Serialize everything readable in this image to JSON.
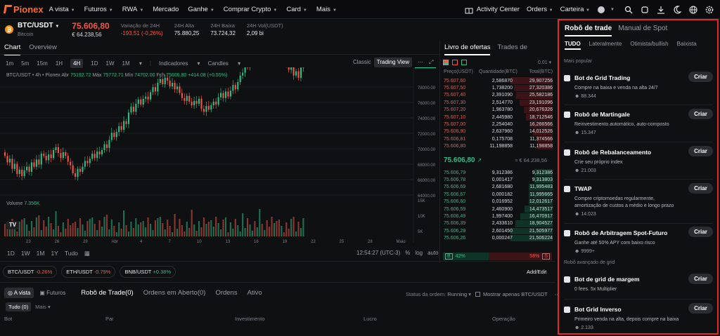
{
  "nav": {
    "logo": "Pionex",
    "items": [
      {
        "label": "A vista",
        "caret": true
      },
      {
        "label": "Futuros",
        "caret": true
      },
      {
        "label": "RWA",
        "caret": true
      },
      {
        "label": "Mercado",
        "caret": false
      },
      {
        "label": "Ganhe",
        "caret": true
      },
      {
        "label": "Comprar Crypto",
        "caret": true
      },
      {
        "label": "Card",
        "caret": true
      },
      {
        "label": "Mais",
        "caret": true
      }
    ],
    "activity": "Activity Center",
    "orders": "Orders",
    "wallet": "Carteira"
  },
  "ticker": {
    "pair": "BTC/USDT",
    "coin": "Bitcoin",
    "price": "75.606,80",
    "price_sub": "€ 64.238,56",
    "stats": [
      {
        "label": "Variação de 24H",
        "value": "-193,51 (-0,26%)",
        "color": "red"
      },
      {
        "label": "24H Alta",
        "value": "75.880,25"
      },
      {
        "label": "24H Baixa",
        "value": "73.724,32"
      },
      {
        "label": "24H Vol(USDT)",
        "value": "2,09 bi"
      }
    ]
  },
  "chart_tabs": [
    "Chart",
    "Overview"
  ],
  "toolbar": {
    "intervals": [
      "1m",
      "5m",
      "15m",
      "1H",
      "4H",
      "1D",
      "1W",
      "1M"
    ],
    "selected": "4H",
    "indicators": "Indicadores",
    "candles": "Candles",
    "views": [
      "Classic",
      "Trading View"
    ]
  },
  "ohlc": {
    "prefix": "BTC/USDT • 4h • Pionex",
    "abr_label": "Abr",
    "abr": "75192.72",
    "max_label": "Máx",
    "max": "75772.71",
    "min_label": "Mín",
    "min": "74702.00",
    "fch_label": "Fch",
    "fch": "75606.80",
    "chg": "+414.08 (+0.55%)"
  },
  "volume": {
    "label": "Volume",
    "value": "7.356K"
  },
  "chart_data": {
    "type": "candlestick",
    "y_ticks": [
      "78000.00",
      "76000.00",
      "74000.00",
      "72000.00",
      "70000.00",
      "68000.00",
      "66000.00",
      "64000.00"
    ],
    "x_ticks": [
      "23",
      "26",
      "29",
      "Abr",
      "4",
      "7",
      "10",
      "13",
      "16",
      "19",
      "22",
      "25",
      "28",
      "Maio"
    ],
    "last_price": "75606.80",
    "volume_ticks": [
      "15K",
      "10K",
      "5K"
    ],
    "ylim": [
      63000,
      79000
    ],
    "closes": [
      68700,
      67800,
      68300,
      66900,
      67600,
      66200,
      66800,
      65900,
      66700,
      67200,
      66500,
      67800,
      67200,
      68200,
      67500,
      69000,
      68700,
      68100,
      68900,
      68400,
      69500,
      69900,
      69100,
      68400,
      69200,
      68700,
      67900,
      67400,
      66300,
      65800,
      66900,
      66500,
      67200,
      68000,
      67700,
      68300,
      69000,
      68400,
      69300,
      68900,
      69500,
      70300,
      69800,
      70900,
      71900,
      71300,
      72000,
      72800,
      72300,
      73500,
      73100,
      74700,
      75500,
      74800,
      75900,
      76500,
      75800,
      76600,
      76900,
      76500,
      77500,
      78200,
      77600,
      78800,
      79300,
      78600,
      79500,
      79100,
      78300,
      78800,
      77900,
      78300,
      77400,
      76700,
      76300,
      77000,
      76200,
      75700,
      76300,
      75900,
      76600,
      75200,
      74800,
      75600,
      75100,
      75700,
      76200,
      75800,
      76800,
      77400,
      76700,
      77600,
      76900,
      77700,
      78500,
      77900,
      78900,
      79800,
      80200,
      81400,
      80900,
      81800,
      82500,
      82100,
      83200,
      84300,
      83700,
      84500,
      83600,
      83000,
      82300,
      83100,
      81900,
      81500,
      82600,
      81700,
      81200,
      80600,
      81400,
      79800,
      80400,
      79500,
      80900,
      81300
    ]
  },
  "bottom_tools": {
    "ranges": [
      "1D",
      "1W",
      "1M",
      "1Y",
      "Tudo"
    ],
    "time": "12:54:27 (UTC-3)",
    "pct": "%",
    "log": "log",
    "auto": "auto"
  },
  "chips": [
    {
      "pair": "BTC/USDT",
      "chg": "-0.26%",
      "color": "r"
    },
    {
      "pair": "ETH/USDT",
      "chg": "-0.79%",
      "color": "r"
    },
    {
      "pair": "BNB/USDT",
      "chg": "+0.38%",
      "color": "g"
    }
  ],
  "add_edit": "Add/Edit",
  "bottom_tabs": {
    "spot": "A vista",
    "futures": "Futuros",
    "tabs": [
      "Robô de Trade(0)",
      "Ordens em Aberto(0)",
      "Ordens",
      "Ativo"
    ],
    "status_label": "Status da ordem:",
    "status_value": "Running",
    "only_label": "Mostrar apenas BTC/USDT",
    "filter_all": "Tudo (0)",
    "filter_more": "Mais",
    "headers": [
      "Bot",
      "Par",
      "Investimento",
      "Lucro",
      "Operação"
    ]
  },
  "orderbook": {
    "tabs": [
      "Livro de ofertas",
      "Trades de"
    ],
    "precision": "0.01",
    "headers": [
      "Preço(USDT)",
      "Quantidade(BTC)",
      "Total(BTC)"
    ],
    "asks": [
      [
        "75.607,60",
        "2,586870",
        "29,907256"
      ],
      [
        "75.607,50",
        "1,738200",
        "27,320386"
      ],
      [
        "75.607,40",
        "2,391090",
        "25,582186"
      ],
      [
        "75.607,30",
        "2,514770",
        "23,191096"
      ],
      [
        "75.607,20",
        "1,963780",
        "20,676326"
      ],
      [
        "75.607,10",
        "2,445980",
        "18,712546"
      ],
      [
        "75.607,00",
        "2,254040",
        "16,266566"
      ],
      [
        "75.606,90",
        "2,637960",
        "14,012526"
      ],
      [
        "75.606,81",
        "0,175708",
        "11,374566"
      ],
      [
        "75.606,80",
        "11,198858",
        "11,198858"
      ]
    ],
    "ask_fill": [
      1.0,
      0.91,
      0.86,
      0.78,
      0.69,
      0.63,
      0.54,
      0.47,
      0.38,
      0.37
    ],
    "mid_price": "75.606,80",
    "mid_sub": "≈ € 64.238,56",
    "bids": [
      [
        "75.606,79",
        "9,312386",
        "9,312386"
      ],
      [
        "75.606,78",
        "0,001417",
        "9,313803"
      ],
      [
        "75.606,69",
        "2,681680",
        "11,995483"
      ],
      [
        "75.606,67",
        "0,000182",
        "11,995665"
      ],
      [
        "75.606,60",
        "0,016952",
        "12,012617"
      ],
      [
        "75.606,59",
        "2,460900",
        "14,473517"
      ],
      [
        "75.606,49",
        "1,997400",
        "16,470917"
      ],
      [
        "75.606,39",
        "2,433610",
        "18,904527"
      ],
      [
        "75.606,29",
        "2,601450",
        "21,505977"
      ],
      [
        "75.606,26",
        "0,000247",
        "21,506224"
      ]
    ],
    "bid_fill": [
      0.43,
      0.43,
      0.56,
      0.56,
      0.56,
      0.67,
      0.77,
      0.88,
      1.0,
      1.0
    ],
    "ratio_buy": "42%",
    "ratio_sell": "58%",
    "ratio_b": "B",
    "ratio_s": "S"
  },
  "bot_panel": {
    "tab_active": "Robô de trade",
    "tab_other": "Manual de Spot",
    "subtabs": [
      "TUDO",
      "Lateralmente",
      "Otimista/bullish",
      "Baixista"
    ],
    "section_popular": "Mais popular",
    "section_advanced": "Robô avançado de grid",
    "create": "Criar",
    "bots": [
      {
        "title": "Bot de Grid Trading",
        "desc": "Compre na baixa e venda na alta 24/7",
        "stat": "88.344"
      },
      {
        "title": "Robô de Martingale",
        "desc": "Reinvestimento automático, auto-composto",
        "stat": "15.347"
      },
      {
        "title": "Robô de Rebalanceamento",
        "desc": "Crie seu próprio index",
        "stat": "21.003"
      },
      {
        "title": "TWAP",
        "desc": "Compre criptomoedas regularmente, amortização de custos a médio e longo prazo",
        "stat": "14.023"
      },
      {
        "title": "Robô de Arbitragem Spot-Futuro",
        "desc": "Ganhe até 50% APY com baixo risco",
        "stat": "9999+"
      },
      {
        "title": "Bot de grid de margem",
        "desc": "0 fees. 5x Multiplier",
        "stat": ""
      },
      {
        "title": "Bot Grid Inverso",
        "desc": "Primeiro venda na alta, depois compre na baixa",
        "stat": "2.133"
      }
    ]
  }
}
